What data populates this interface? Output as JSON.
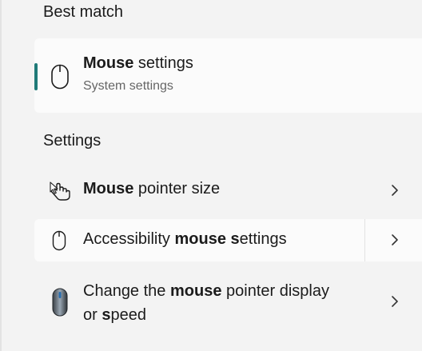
{
  "best_match": {
    "section_title": "Best match",
    "item": {
      "title_bold": "Mouse",
      "title_rest": " settings",
      "subtitle": "System settings",
      "icon": "mouse-icon"
    }
  },
  "settings": {
    "section_title": "Settings",
    "items": [
      {
        "parts": [
          {
            "t": "Mouse",
            "b": true
          },
          {
            "t": " pointer size",
            "b": false
          }
        ],
        "icon": "pointer-hand-icon"
      },
      {
        "parts": [
          {
            "t": "Accessibility ",
            "b": false
          },
          {
            "t": "mouse",
            "b": true
          },
          {
            "t": " ",
            "b": false
          },
          {
            "t": "s",
            "b": true
          },
          {
            "t": "ettings",
            "b": false
          }
        ],
        "icon": "mouse-icon"
      },
      {
        "parts": [
          {
            "t": "Change the ",
            "b": false
          },
          {
            "t": "mouse",
            "b": true
          },
          {
            "t": " pointer display or ",
            "b": false
          },
          {
            "t": "s",
            "b": true
          },
          {
            "t": "peed",
            "b": false
          }
        ],
        "icon": "mouse-3d-icon"
      }
    ]
  },
  "colors": {
    "accent": "#1f7a78",
    "background": "#f3f3f3",
    "card": "#fbfbfb"
  }
}
